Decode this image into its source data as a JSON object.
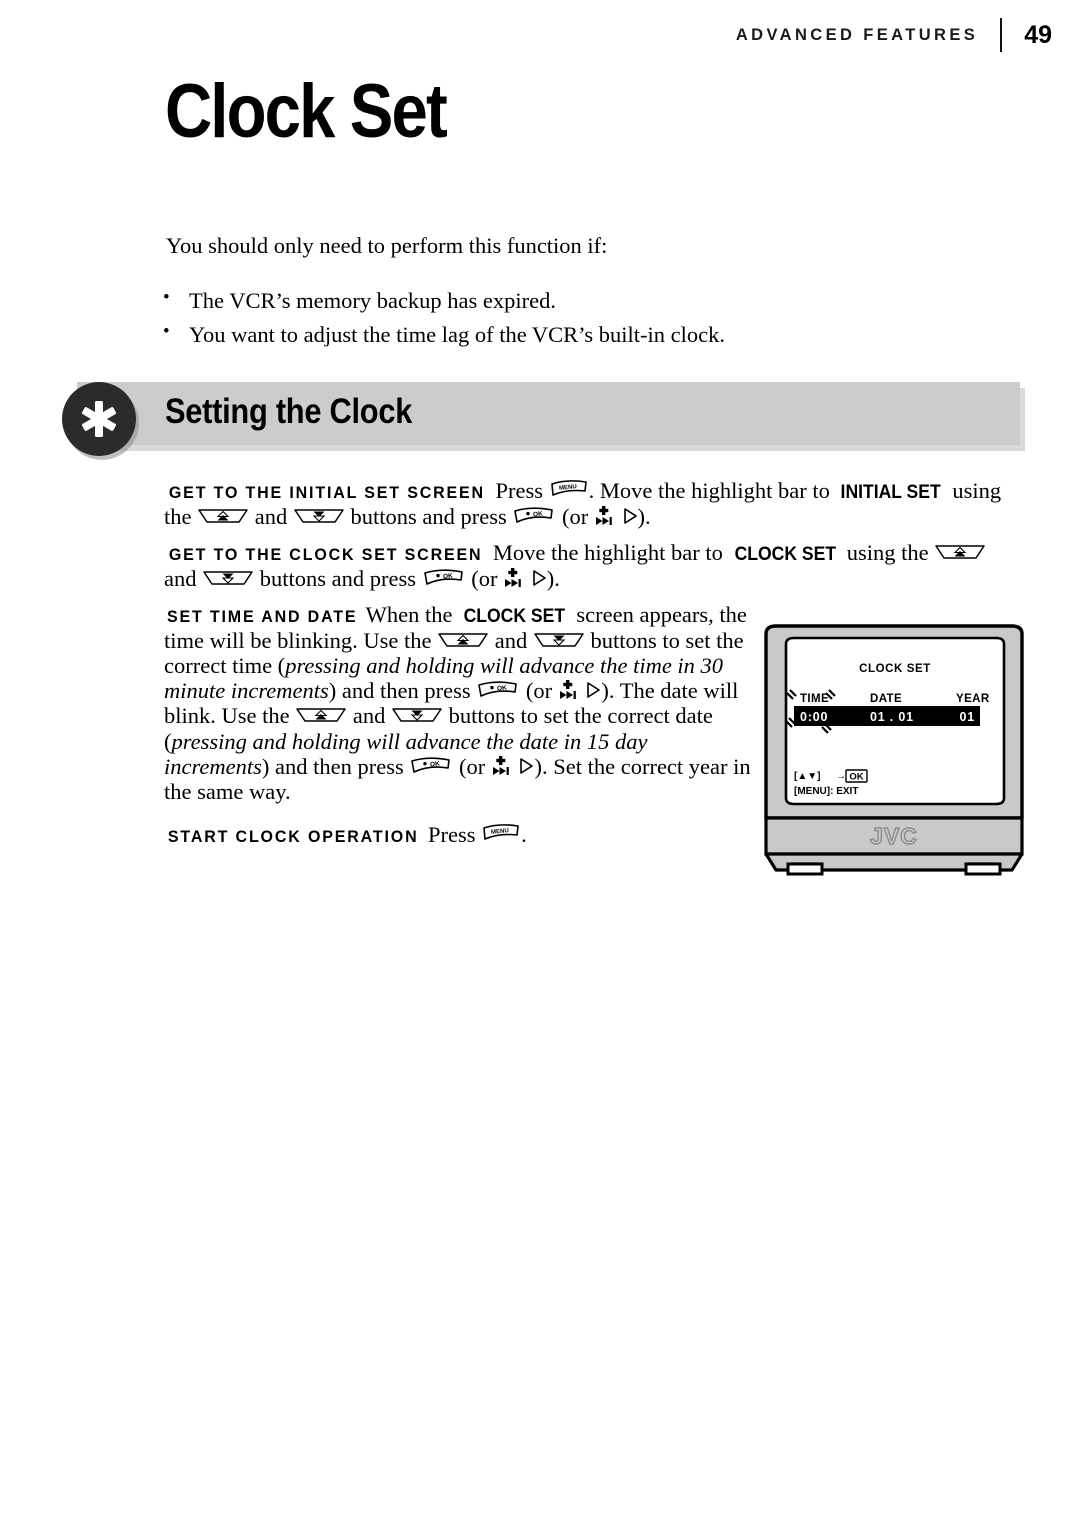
{
  "header": {
    "section": "ADVANCED FEATURES",
    "page_number": "49"
  },
  "page_title": "Clock Set",
  "intro": {
    "lead": "You should only need to perform this function if:",
    "bullet_marker": "•",
    "bullets": [
      "The VCR’s memory backup has expired.",
      "You want to adjust the time lag of the VCR’s built-in clock."
    ]
  },
  "section": {
    "badge_icon": "asterisk-icon",
    "heading": "Setting the Clock"
  },
  "steps": [
    {
      "lead": "GET TO THE INITIAL SET SCREEN",
      "t1": "Press",
      "icon1": "menu-button-icon",
      "t2": ". Move the highlight bar to",
      "kw": "INITIAL SET",
      "t3": "using the",
      "icon2": "channel-up-button-icon",
      "t4": "and",
      "icon3": "channel-down-button-icon",
      "t5": "buttons and press",
      "icon4": "ok-button-icon",
      "t6": "(or",
      "icon5": "skip-forward-plus-icon",
      "icon6": "play-right-triangle-icon",
      "t7": ")."
    },
    {
      "lead": "GET TO THE CLOCK SET SCREEN",
      "t1": "Move the highlight bar to",
      "kw": "CLOCK SET",
      "t2": "using the",
      "icon1": "channel-up-button-icon",
      "t3": "and",
      "icon2": "channel-down-button-icon",
      "t4": "buttons and press",
      "icon3": "ok-button-icon",
      "t5": "(or",
      "icon4": "skip-forward-plus-icon",
      "icon5": "play-right-triangle-icon",
      "t6": ")."
    },
    {
      "lead": "SET TIME AND DATE",
      "t1": "When the",
      "kw1": "CLOCK SET",
      "t2": "screen appears, the time will be blinking. Use the",
      "icon1": "channel-up-button-icon",
      "t3": "and",
      "icon2": "channel-down-button-icon",
      "t4": "buttons to set the correct time (",
      "em1": "pressing and holding will advance the time in 30 minute increments",
      "t5": ") and then press",
      "icon3": "ok-button-icon",
      "t6": "(or",
      "icon4": "skip-forward-plus-icon",
      "icon5": "play-right-triangle-icon",
      "t7": "). The date will blink. Use the",
      "icon6": "channel-up-button-icon",
      "t8": "and",
      "icon7": "channel-down-button-icon",
      "t9": "buttons to set the correct date (",
      "em2": "pressing and holding will advance the date in 15 day increments",
      "t10": ") and then press",
      "icon8": "ok-button-icon",
      "t11": "(or",
      "icon9": "skip-forward-plus-icon",
      "icon10": "play-right-triangle-icon",
      "t12": "). Set the correct year in the same way."
    },
    {
      "lead": "START CLOCK OPERATION",
      "t1": "Press",
      "icon1": "menu-button-icon",
      "t2": "."
    }
  ],
  "illustration": {
    "device": "crt-television",
    "brand": "JVC",
    "screen": {
      "title": "CLOCK SET",
      "columns": [
        "TIME",
        "DATE",
        "YEAR"
      ],
      "values": [
        "0:00",
        "01 . 01",
        "01"
      ],
      "blink_indicator": "blink-marks-icon",
      "footer_line1_left": "[▲▼]",
      "footer_line1_arrow": "→",
      "footer_line1_key": "OK",
      "footer_line2": "[MENU]: EXIT"
    }
  },
  "icon_labels": {
    "menu": "MENU",
    "ok": "OK"
  },
  "colors": {
    "banner_bg": "#cccccc",
    "badge_bg": "#2b2b2b",
    "tv_bezel": "#c9c9c9",
    "screen_bg": "#ffffff",
    "highlight_bar": "#000000",
    "text": "#000000"
  }
}
